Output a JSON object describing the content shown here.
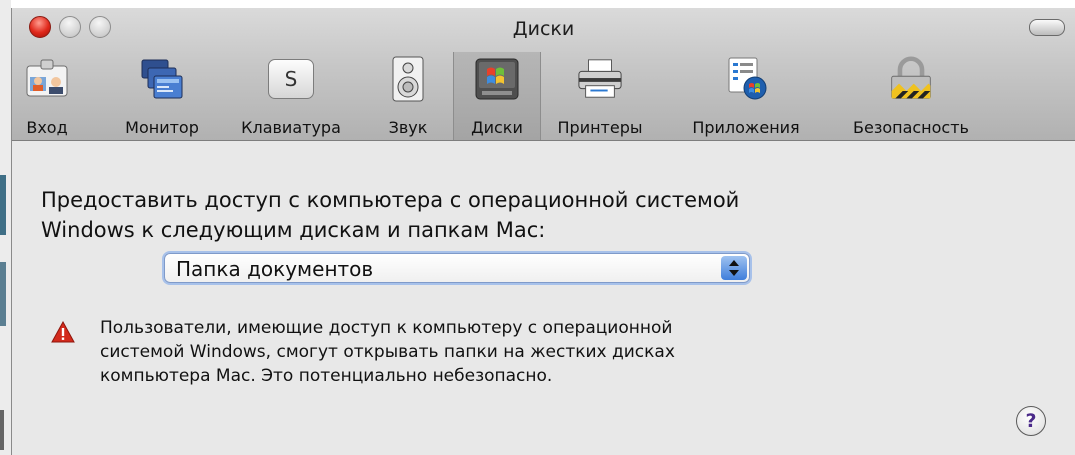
{
  "window": {
    "title": "Диски"
  },
  "toolbar": {
    "items": [
      {
        "label": "Вход",
        "icon": "accounts-icon"
      },
      {
        "label": "Монитор",
        "icon": "displays-icon"
      },
      {
        "label": "Клавиатура",
        "icon": "keyboard-icon",
        "icon_text": "S"
      },
      {
        "label": "Звук",
        "icon": "speaker-icon"
      },
      {
        "label": "Диски",
        "icon": "disks-icon"
      },
      {
        "label": "Принтеры",
        "icon": "printer-icon"
      },
      {
        "label": "Приложения",
        "icon": "applications-icon"
      },
      {
        "label": "Безопасность",
        "icon": "lock-icon"
      }
    ],
    "selected": "Диски"
  },
  "content": {
    "prompt_line1": "Предоставить доступ с компьютера с операционной системой",
    "prompt_line2": "Windows к следующим дискам и папкам Mac:",
    "popup": {
      "value": "Папка документов"
    },
    "warning": {
      "line1": "Пользователи, имеющие доступ к компьютеру с операционной",
      "line2": "системой Windows, смогут открывать папки на жестких дисках",
      "line3": "компьютера Mac. Это потенциально небезопасно."
    },
    "help": {
      "glyph": "?"
    }
  },
  "colors": {
    "accent": "#3f7edb",
    "close": "#e0281b",
    "warning": "#d32a1c"
  }
}
